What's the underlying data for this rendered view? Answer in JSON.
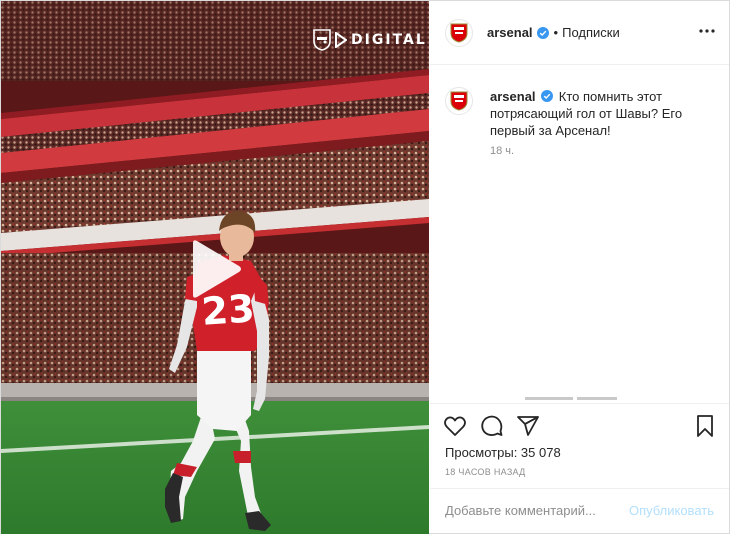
{
  "media": {
    "watermark": "DIGITAL",
    "player_number": "23"
  },
  "header": {
    "username": "arsenal",
    "separator": "•",
    "follow_label": "Подписки"
  },
  "caption": {
    "username": "arsenal",
    "text": "Кто помнить этот потрясающий гол от Шавы? Его первый за Арсенал!",
    "time": "18 ч."
  },
  "actions": {
    "views_label": "Просмотры: 35 078",
    "timestamp": "18 ЧАСОВ НАЗАД"
  },
  "comment": {
    "placeholder": "Добавьте комментарий...",
    "publish_label": "Опубликовать"
  },
  "colors": {
    "verified": "#3897f0",
    "publish_disabled": "#b2dffc",
    "arsenal_red": "#db0007"
  },
  "icons": {
    "like": "heart-icon",
    "comment": "comment-icon",
    "share": "paper-plane-icon",
    "save": "bookmark-icon",
    "more": "more-horizontal-icon",
    "play": "play-icon"
  }
}
